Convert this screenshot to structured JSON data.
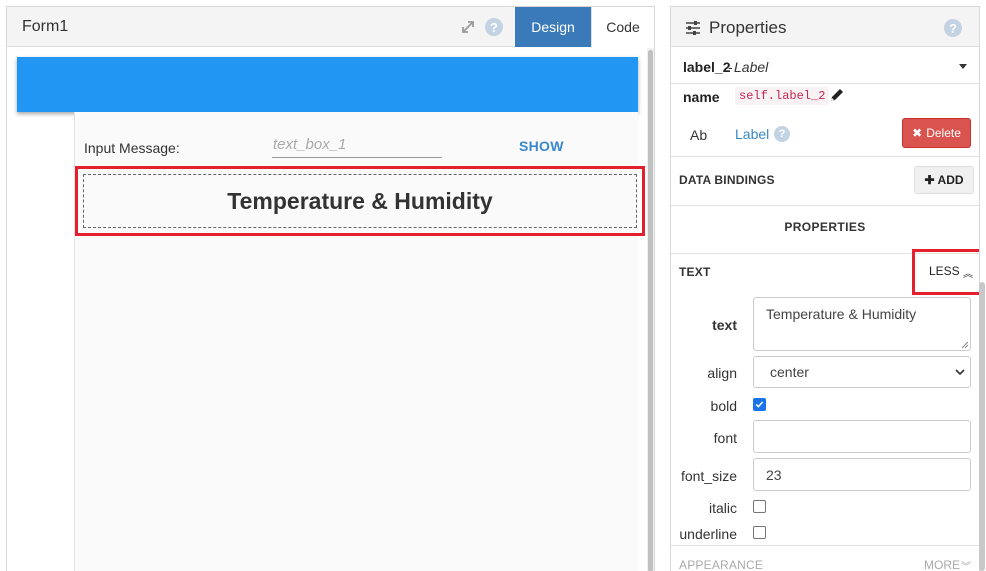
{
  "form": {
    "title": "Form1",
    "tabs": [
      {
        "label": "Design",
        "active": true
      },
      {
        "label": "Code",
        "active": false
      }
    ],
    "banner_color": "#2196f3",
    "input_label": "Input Message:",
    "text_box_placeholder": "text_box_1",
    "show_button": "SHOW",
    "selected_label_text": "Temperature & Humidity"
  },
  "properties": {
    "title": "Properties",
    "component_name": "label_2",
    "component_separator": "-",
    "component_type": "Label",
    "name_label": "name",
    "name_value": "self.label_2",
    "type_icon_text": "Ab",
    "type_link": "Label",
    "delete_button": "Delete",
    "data_bindings_label": "DATA BINDINGS",
    "add_button": "ADD",
    "properties_heading": "PROPERTIES",
    "text_section_label": "TEXT",
    "less_button": "LESS",
    "fields": {
      "text_label": "text",
      "text_value": "Temperature & Humidity",
      "align_label": "align",
      "align_value": "center",
      "bold_label": "bold",
      "bold_checked": true,
      "font_label": "font",
      "font_value": "",
      "font_size_label": "font_size",
      "font_size_value": "23",
      "italic_label": "italic",
      "italic_checked": false,
      "underline_label": "underline",
      "underline_checked": false
    },
    "appearance_label": "APPEARANCE",
    "more_button": "MORE"
  },
  "colors": {
    "accent_tab": "#3a7ab8",
    "highlight_red": "#e5202e",
    "delete_red": "#d9534f",
    "link_blue": "#3a87cc"
  }
}
